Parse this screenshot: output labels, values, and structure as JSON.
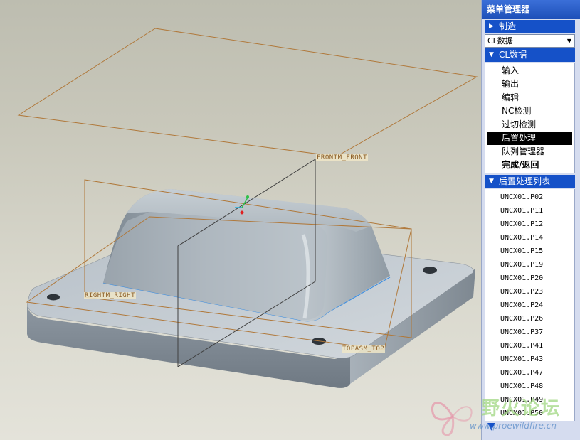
{
  "viewport": {
    "datums": {
      "front": "FRONTM_FRONT",
      "right": "RIGHTM_RIGHT",
      "top": "TOPASM_TOP"
    }
  },
  "menu_manager": {
    "title": "菜单管理器",
    "manufacture_header": "制造",
    "cl_dropdown_value": "CL数据",
    "cl_section_header": "CL数据",
    "cl_items": [
      "输入",
      "输出",
      "编辑",
      "NC检测",
      "过切检测",
      "后置处理",
      "队列管理器",
      "完成/返回"
    ],
    "selected_item": "后置处理",
    "post_list_header": "后置处理列表",
    "post_files": [
      "UNCX01.P02",
      "UNCX01.P11",
      "UNCX01.P12",
      "UNCX01.P14",
      "UNCX01.P15",
      "UNCX01.P19",
      "UNCX01.P20",
      "UNCX01.P23",
      "UNCX01.P24",
      "UNCX01.P26",
      "UNCX01.P37",
      "UNCX01.P41",
      "UNCX01.P43",
      "UNCX01.P47",
      "UNCX01.P48",
      "UNCX01.P49",
      "UNCX01.P50"
    ]
  },
  "watermark": {
    "title": "野火论坛",
    "url": "www.proewildfire.cn"
  },
  "colors": {
    "viewport_bg": "#c9c8bb",
    "datum_plane": "#b0783a",
    "part_body": "#9aa4ad",
    "menu_header": "#1551c8",
    "selection": "#000000"
  },
  "icons": {
    "expand": "triangle-right-icon",
    "collapse": "triangle-down-icon",
    "scroll": "triangle-down-icon"
  }
}
